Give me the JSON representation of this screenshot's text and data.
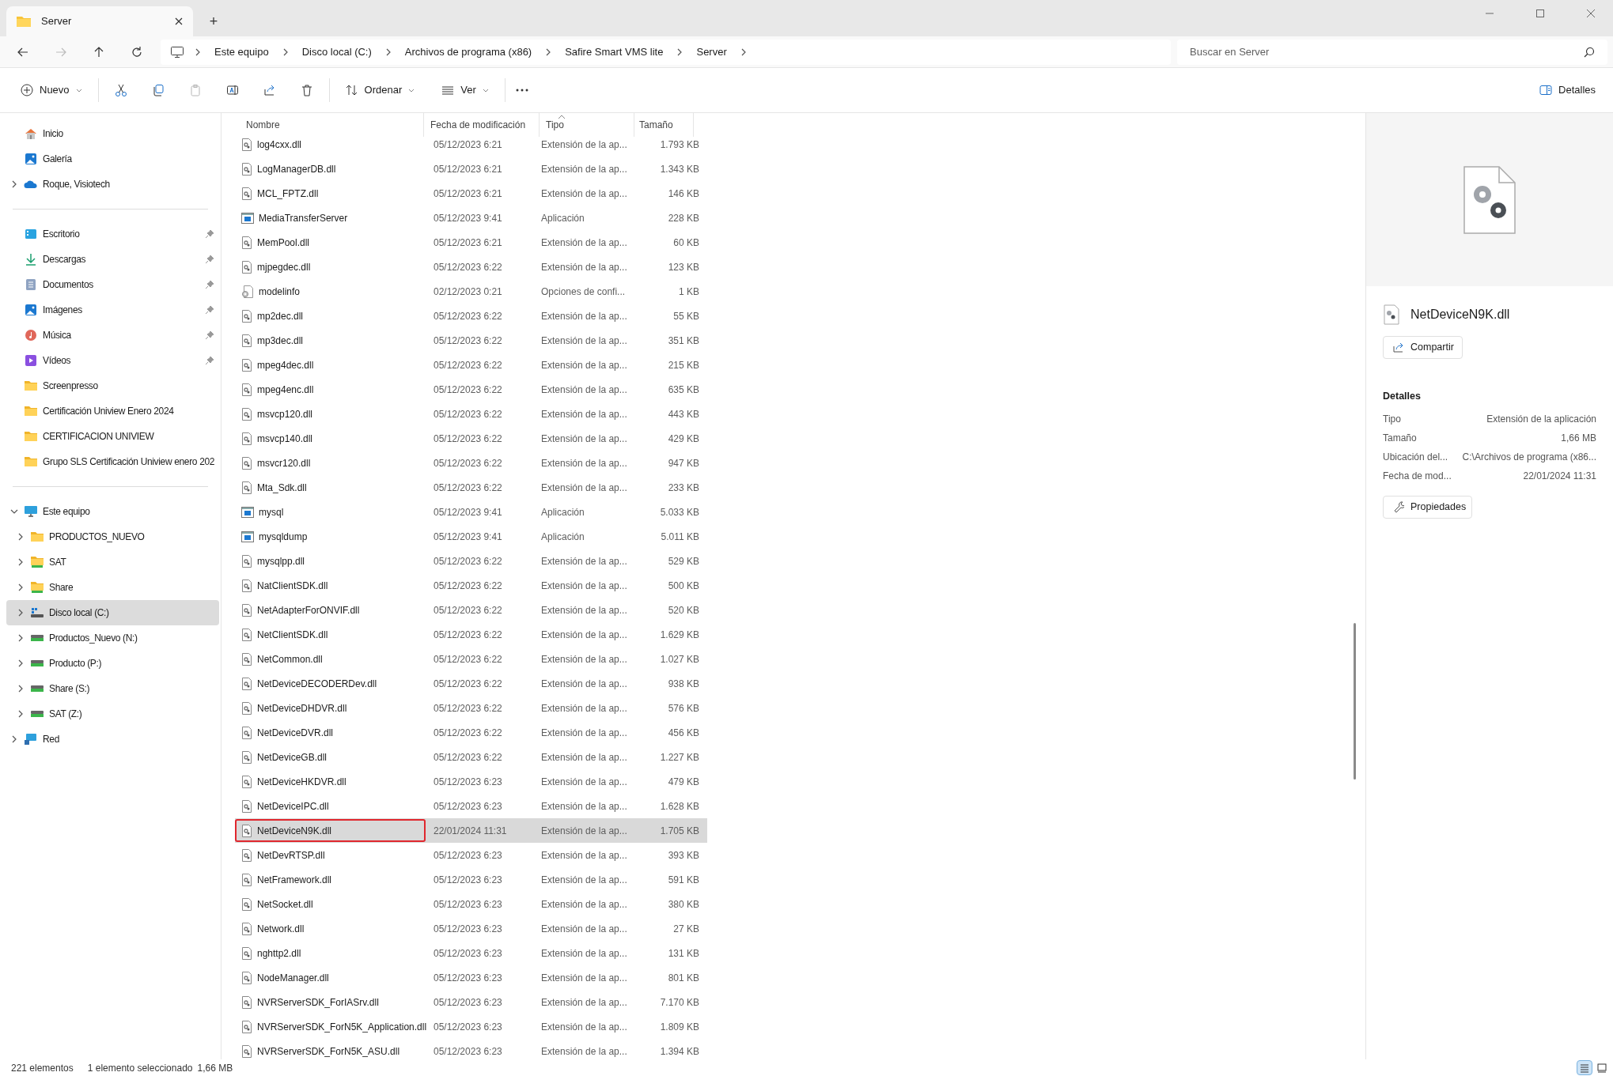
{
  "window": {
    "tab_title": "Server",
    "new_tab": "+"
  },
  "address_bar": {
    "breadcrumbs": [
      "Este equipo",
      "Disco local (C:)",
      "Archivos de programa (x86)",
      "Safire Smart VMS lite",
      "Server"
    ]
  },
  "search": {
    "placeholder": "Buscar en Server"
  },
  "toolbar": {
    "new": "Nuevo",
    "sort": "Ordenar",
    "view": "Ver",
    "details": "Detalles",
    "paste_disabled": true
  },
  "sidebar": {
    "groups": [
      [
        {
          "label": "Inicio",
          "kind": "home",
          "selected": false
        },
        {
          "label": "Galería",
          "kind": "gallery",
          "selected": false
        },
        {
          "label": "Roque, Visiotech",
          "kind": "cloud",
          "selected": false,
          "expanded": false
        }
      ],
      [
        {
          "label": "Escritorio",
          "kind": "desktop",
          "selected": false,
          "pinned": true
        },
        {
          "label": "Descargas",
          "kind": "download",
          "selected": false,
          "pinned": true
        },
        {
          "label": "Documentos",
          "kind": "documents",
          "selected": false,
          "pinned": true
        },
        {
          "label": "Imágenes",
          "kind": "pictures",
          "selected": false,
          "pinned": true
        },
        {
          "label": "Música",
          "kind": "music",
          "selected": false,
          "pinned": true
        },
        {
          "label": "Vídeos",
          "kind": "videos",
          "selected": false,
          "pinned": true
        },
        {
          "label": "Screenpresso",
          "kind": "folder",
          "selected": false,
          "pinned": false
        },
        {
          "label": "Certificación Uniview Enero 2024",
          "kind": "folder",
          "selected": false,
          "pinned": false
        },
        {
          "label": "CERTIFICACION UNIVIEW",
          "kind": "folder",
          "selected": false,
          "pinned": false
        },
        {
          "label": "Grupo SLS Certificación Uniview enero 202",
          "kind": "folder",
          "selected": false,
          "pinned": false
        }
      ],
      [
        {
          "label": "Este equipo",
          "kind": "computer",
          "selected": false,
          "expanded": true,
          "children": [
            {
              "label": "PRODUCTOS_NUEVO",
              "kind": "folder",
              "selected": false,
              "expanded": false
            },
            {
              "label": "SAT",
              "kind": "netfolder",
              "selected": false,
              "expanded": false
            },
            {
              "label": "Share",
              "kind": "netfolder",
              "selected": false,
              "expanded": false
            },
            {
              "label": "Disco local (C:)",
              "kind": "systemdrive",
              "selected": true,
              "expanded": false
            },
            {
              "label": "Productos_Nuevo (N:)",
              "kind": "drive",
              "selected": false,
              "expanded": false
            },
            {
              "label": "Producto (P:)",
              "kind": "drive",
              "selected": false,
              "expanded": false
            },
            {
              "label": "Share (S:)",
              "kind": "drive",
              "selected": false,
              "expanded": false
            },
            {
              "label": "SAT (Z:)",
              "kind": "drive",
              "selected": false,
              "expanded": false
            }
          ]
        },
        {
          "label": "Red",
          "kind": "network",
          "selected": false,
          "expanded": false
        }
      ]
    ]
  },
  "table": {
    "columns": [
      "Nombre",
      "Fecha de modificación",
      "Tipo",
      "Tamaño"
    ],
    "sort_ascending": true,
    "rows": [
      {
        "name": "log4cxx.dll",
        "kind": "dll",
        "date": "05/12/2023 6:21",
        "type": "Extensión de la ap...",
        "size": "1.793 KB",
        "selected": false,
        "marked": false
      },
      {
        "name": "LogManagerDB.dll",
        "kind": "dll",
        "date": "05/12/2023 6:21",
        "type": "Extensión de la ap...",
        "size": "1.343 KB",
        "selected": false,
        "marked": false
      },
      {
        "name": "MCL_FPTZ.dll",
        "kind": "dll",
        "date": "05/12/2023 6:21",
        "type": "Extensión de la ap...",
        "size": "146 KB",
        "selected": false,
        "marked": false
      },
      {
        "name": "MediaTransferServer",
        "kind": "app",
        "date": "05/12/2023 9:41",
        "type": "Aplicación",
        "size": "228 KB",
        "selected": false,
        "marked": false
      },
      {
        "name": "MemPool.dll",
        "kind": "dll",
        "date": "05/12/2023 6:21",
        "type": "Extensión de la ap...",
        "size": "60 KB",
        "selected": false,
        "marked": false
      },
      {
        "name": "mjpegdec.dll",
        "kind": "dll",
        "date": "05/12/2023 6:22",
        "type": "Extensión de la ap...",
        "size": "123 KB",
        "selected": false,
        "marked": false
      },
      {
        "name": "modelinfo",
        "kind": "config",
        "date": "02/12/2023 0:21",
        "type": "Opciones de confi...",
        "size": "1 KB",
        "selected": false,
        "marked": false
      },
      {
        "name": "mp2dec.dll",
        "kind": "dll",
        "date": "05/12/2023 6:22",
        "type": "Extensión de la ap...",
        "size": "55 KB",
        "selected": false,
        "marked": false
      },
      {
        "name": "mp3dec.dll",
        "kind": "dll",
        "date": "05/12/2023 6:22",
        "type": "Extensión de la ap...",
        "size": "351 KB",
        "selected": false,
        "marked": false
      },
      {
        "name": "mpeg4dec.dll",
        "kind": "dll",
        "date": "05/12/2023 6:22",
        "type": "Extensión de la ap...",
        "size": "215 KB",
        "selected": false,
        "marked": false
      },
      {
        "name": "mpeg4enc.dll",
        "kind": "dll",
        "date": "05/12/2023 6:22",
        "type": "Extensión de la ap...",
        "size": "635 KB",
        "selected": false,
        "marked": false
      },
      {
        "name": "msvcp120.dll",
        "kind": "dll",
        "date": "05/12/2023 6:22",
        "type": "Extensión de la ap...",
        "size": "443 KB",
        "selected": false,
        "marked": false
      },
      {
        "name": "msvcp140.dll",
        "kind": "dll",
        "date": "05/12/2023 6:22",
        "type": "Extensión de la ap...",
        "size": "429 KB",
        "selected": false,
        "marked": false
      },
      {
        "name": "msvcr120.dll",
        "kind": "dll",
        "date": "05/12/2023 6:22",
        "type": "Extensión de la ap...",
        "size": "947 KB",
        "selected": false,
        "marked": false
      },
      {
        "name": "Mta_Sdk.dll",
        "kind": "dll",
        "date": "05/12/2023 6:22",
        "type": "Extensión de la ap...",
        "size": "233 KB",
        "selected": false,
        "marked": false
      },
      {
        "name": "mysql",
        "kind": "app",
        "date": "05/12/2023 9:41",
        "type": "Aplicación",
        "size": "5.033 KB",
        "selected": false,
        "marked": false
      },
      {
        "name": "mysqldump",
        "kind": "app",
        "date": "05/12/2023 9:41",
        "type": "Aplicación",
        "size": "5.011 KB",
        "selected": false,
        "marked": false
      },
      {
        "name": "mysqlpp.dll",
        "kind": "dll",
        "date": "05/12/2023 6:22",
        "type": "Extensión de la ap...",
        "size": "529 KB",
        "selected": false,
        "marked": false
      },
      {
        "name": "NatClientSDK.dll",
        "kind": "dll",
        "date": "05/12/2023 6:22",
        "type": "Extensión de la ap...",
        "size": "500 KB",
        "selected": false,
        "marked": false
      },
      {
        "name": "NetAdapterForONVIF.dll",
        "kind": "dll",
        "date": "05/12/2023 6:22",
        "type": "Extensión de la ap...",
        "size": "520 KB",
        "selected": false,
        "marked": false
      },
      {
        "name": "NetClientSDK.dll",
        "kind": "dll",
        "date": "05/12/2023 6:22",
        "type": "Extensión de la ap...",
        "size": "1.629 KB",
        "selected": false,
        "marked": false
      },
      {
        "name": "NetCommon.dll",
        "kind": "dll",
        "date": "05/12/2023 6:22",
        "type": "Extensión de la ap...",
        "size": "1.027 KB",
        "selected": false,
        "marked": false
      },
      {
        "name": "NetDeviceDECODERDev.dll",
        "kind": "dll",
        "date": "05/12/2023 6:22",
        "type": "Extensión de la ap...",
        "size": "938 KB",
        "selected": false,
        "marked": false
      },
      {
        "name": "NetDeviceDHDVR.dll",
        "kind": "dll",
        "date": "05/12/2023 6:22",
        "type": "Extensión de la ap...",
        "size": "576 KB",
        "selected": false,
        "marked": false
      },
      {
        "name": "NetDeviceDVR.dll",
        "kind": "dll",
        "date": "05/12/2023 6:22",
        "type": "Extensión de la ap...",
        "size": "456 KB",
        "selected": false,
        "marked": false
      },
      {
        "name": "NetDeviceGB.dll",
        "kind": "dll",
        "date": "05/12/2023 6:22",
        "type": "Extensión de la ap...",
        "size": "1.227 KB",
        "selected": false,
        "marked": false
      },
      {
        "name": "NetDeviceHKDVR.dll",
        "kind": "dll",
        "date": "05/12/2023 6:23",
        "type": "Extensión de la ap...",
        "size": "479 KB",
        "selected": false,
        "marked": false
      },
      {
        "name": "NetDeviceIPC.dll",
        "kind": "dll",
        "date": "05/12/2023 6:23",
        "type": "Extensión de la ap...",
        "size": "1.628 KB",
        "selected": false,
        "marked": false
      },
      {
        "name": "NetDeviceN9K.dll",
        "kind": "dll",
        "date": "22/01/2024 11:31",
        "type": "Extensión de la ap...",
        "size": "1.705 KB",
        "selected": true,
        "marked": true
      },
      {
        "name": "NetDevRTSP.dll",
        "kind": "dll",
        "date": "05/12/2023 6:23",
        "type": "Extensión de la ap...",
        "size": "393 KB",
        "selected": false,
        "marked": false
      },
      {
        "name": "NetFramework.dll",
        "kind": "dll",
        "date": "05/12/2023 6:23",
        "type": "Extensión de la ap...",
        "size": "591 KB",
        "selected": false,
        "marked": false
      },
      {
        "name": "NetSocket.dll",
        "kind": "dll",
        "date": "05/12/2023 6:23",
        "type": "Extensión de la ap...",
        "size": "380 KB",
        "selected": false,
        "marked": false
      },
      {
        "name": "Network.dll",
        "kind": "dll",
        "date": "05/12/2023 6:23",
        "type": "Extensión de la ap...",
        "size": "27 KB",
        "selected": false,
        "marked": false
      },
      {
        "name": "nghttp2.dll",
        "kind": "dll",
        "date": "05/12/2023 6:23",
        "type": "Extensión de la ap...",
        "size": "131 KB",
        "selected": false,
        "marked": false
      },
      {
        "name": "NodeManager.dll",
        "kind": "dll",
        "date": "05/12/2023 6:23",
        "type": "Extensión de la ap...",
        "size": "801 KB",
        "selected": false,
        "marked": false
      },
      {
        "name": "NVRServerSDK_ForIASrv.dll",
        "kind": "dll",
        "date": "05/12/2023 6:23",
        "type": "Extensión de la ap...",
        "size": "7.170 KB",
        "selected": false,
        "marked": false
      },
      {
        "name": "NVRServerSDK_ForN5K_Application.dll",
        "kind": "dll",
        "date": "05/12/2023 6:23",
        "type": "Extensión de la ap...",
        "size": "1.809 KB",
        "selected": false,
        "marked": false
      },
      {
        "name": "NVRServerSDK_ForN5K_ASU.dll",
        "kind": "dll",
        "date": "05/12/2023 6:23",
        "type": "Extensión de la ap...",
        "size": "1.394 KB",
        "selected": false,
        "marked": false
      }
    ]
  },
  "details_pane": {
    "file_name": "NetDeviceN9K.dll",
    "share": "Compartir",
    "heading": "Detalles",
    "properties": [
      {
        "label": "Tipo",
        "value": "Extensión de la aplicación"
      },
      {
        "label": "Tamaño",
        "value": "1,66 MB"
      },
      {
        "label": "Ubicación del...",
        "value": "C:\\Archivos de programa (x86..."
      },
      {
        "label": "Fecha de mod...",
        "value": "22/01/2024 11:31"
      }
    ],
    "properties_button": "Propiedades"
  },
  "status_bar": {
    "count": "221 elementos",
    "selection": "1 elemento seleccionado",
    "size": "1,66 MB",
    "views": [
      {
        "kind": "details",
        "selected": true
      },
      {
        "kind": "tiles",
        "selected": false
      }
    ]
  }
}
